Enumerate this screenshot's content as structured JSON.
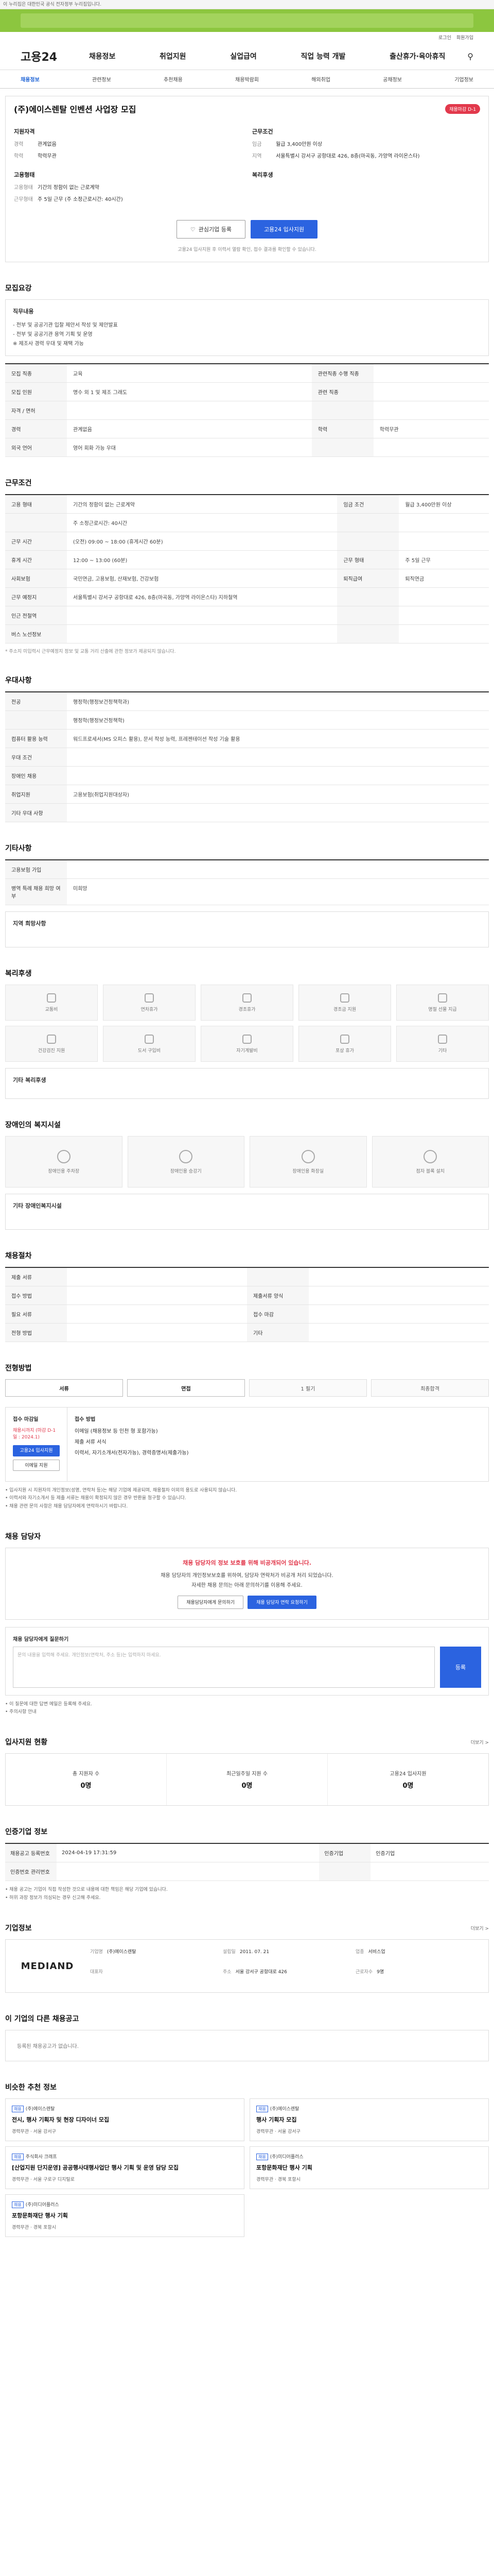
{
  "topbar": {
    "text": "이 누리집은 대한민국 공식 전자정부 누리집입니다."
  },
  "util": [
    "로그인",
    "회원가입"
  ],
  "gnb": {
    "logo": "고용24",
    "menu": [
      "채용정보",
      "취업지원",
      "실업급여",
      "직업 능력 개발",
      "출산휴가·육아휴직"
    ]
  },
  "subnav": [
    "채용정보",
    "관련정보",
    "추천채용",
    "채용박람회",
    "해외취업",
    "공채정보",
    "기업정보"
  ],
  "job": {
    "title": "(주)에이스렌탈 인벤션 사업장 모집",
    "dday": "채용마감 D-1",
    "overview_left_label": "지원자격",
    "overview_right_label": "근무조건",
    "left_kv": [
      {
        "k": "경력",
        "v": "관계없음"
      },
      {
        "k": "학력",
        "v": "학력무관"
      }
    ],
    "right_kv": [
      {
        "k": "임금",
        "v": "월급 3,400만원 이상"
      },
      {
        "k": "지역",
        "v": "서울특별시 강서구 공항대로 426, 8층(마곡동, 가양역 라이온스타)"
      }
    ],
    "employ_label": "고용형태",
    "employ_kv": [
      {
        "k": "고용형태",
        "v": "기간의 정함이 없는 근로계약"
      },
      {
        "k": "근무형태",
        "v": "주 5일 근무 (주 소정근로시간: 40시간)"
      }
    ],
    "welfare_label": "복리후생",
    "btn_interest": "관심기업 등록",
    "btn_apply": "고용24 입사지원",
    "apply_note": "고용24 입사지원 후 이력서 열람 확인, 접수 결과를 확인할 수 있습니다.",
    "apply_note_em": "고용24 입사지원"
  },
  "sections": {
    "recruit": "모집요강",
    "conditions": "근무조건",
    "preference": "우대사항",
    "other": "기타사항",
    "welfare": "복리후생",
    "welfare2": "장애인의 복지시설",
    "process": "채용절차",
    "schedule": "전형방법",
    "manager": "채용 담당자",
    "applicants": "입사지원 현황",
    "meta": "인증기업 정보",
    "company": "기업정보",
    "others": "이 기업의 다른 채용공고",
    "recommended": "비슷한 추천 정보"
  },
  "recruit_box": {
    "title": "직무내용",
    "lines": [
      "- 전부 및 공공기관 입찰 제안서 작성 및 제안발표",
      "- 전부 및 공공기관 용역 기획 및 운영",
      "※ 제조사 경력 우대 및 재택 가능"
    ]
  },
  "recruit_table": [
    {
      "k": "모집 직종",
      "v": "교육",
      "k2": "관련직종 수행 직종",
      "v2": ""
    },
    {
      "k": "모집 인원",
      "v": "명수 외 1 및 제조 그래도",
      "k2": "관련 직종",
      "v2": ""
    },
    {
      "k": "자격 / 면허",
      "v": "",
      "k2": "",
      "v2": ""
    },
    {
      "k": "경력",
      "v": "관계없음",
      "k2": "학력",
      "v2": "학력무관"
    },
    {
      "k": "외국 언어",
      "v": "영어 회화 가능 우대",
      "k2": "",
      "v2": ""
    }
  ],
  "cond_table": [
    {
      "k": "고용 형태",
      "v": "기간의 정함이 없는 근로계약",
      "k2": "임금 조건",
      "v2": "월급 3,400만원 이상"
    },
    {
      "k": "",
      "v": "주 소정근로시간: 40시간",
      "k2": "",
      "v2": ""
    },
    {
      "k": "근무 시간",
      "v": "(오전) 09:00 ~ 18:00 (휴게시간 60분)",
      "k2": "",
      "v2": ""
    },
    {
      "k": "휴게 시간",
      "v": "12:00 ~ 13:00 (60분)",
      "k2": "근무 형태",
      "v2": "주 5일 근무"
    },
    {
      "k": "사회보험",
      "v": "국민연금, 고용보험, 산재보험, 건강보험",
      "k2": "퇴직급여",
      "v2": "퇴직연금"
    },
    {
      "k": "근무 예정지",
      "v": "서울특별시 강서구 공항대로 426, 8층(마곡동, 가양역 라이온스타) 지하철역",
      "k2": "",
      "v2": ""
    },
    {
      "k": "인근 전철역",
      "v": "",
      "k2": "",
      "v2": ""
    },
    {
      "k": "버스 노선정보",
      "v": "",
      "k2": "",
      "v2": ""
    }
  ],
  "cond_note": "* 주소지 미입력시 근무예정지 정보 및 교통 거리 산출에 관한 정보가 제공되지 않습니다.",
  "pref_table": [
    {
      "k": "전공",
      "v": "행정학(행정보건정책학과)"
    },
    {
      "k": "",
      "v": "행정학(행정보건정책학)"
    },
    {
      "k": "컴퓨터 활용 능력",
      "v": "워드프로세서(MS 오피스 활용), 문서 작성 능력, 프레젠테이션 작성 기술 활용"
    },
    {
      "k": "우대 조건",
      "v": ""
    },
    {
      "k": "장애인 채용",
      "v": ""
    },
    {
      "k": "취업지원",
      "v": "고용보험(취업지원대상자)"
    },
    {
      "k": "기타 우대 사항",
      "v": ""
    }
  ],
  "other_table": [
    {
      "k": "고용보험 가입",
      "v": ""
    },
    {
      "k": "병역 특례 채용 희망 여부",
      "v": "미희망"
    }
  ],
  "other_box": "지역 희망사항",
  "welfare_items": [
    "교통비",
    "연차휴가",
    "경조휴가",
    "경조금 지원",
    "명절 선물 지급",
    "건강검진 지원",
    "도서 구입비",
    "자기계발비",
    "포상 휴가",
    "기타"
  ],
  "welfare_detail_label": "기타 복리후생",
  "welfare2_items": [
    "장애인용 주차장",
    "장애인용 승강기",
    "장애인용 화장실",
    "점자 블록 설치"
  ],
  "welfare2_detail_label": "기타 장애인복지시설",
  "process_table": [
    {
      "k": "제출 서류",
      "v": "",
      "k2": "",
      "v2": ""
    },
    {
      "k": "접수 방법",
      "v": "",
      "k2": "제출서류 양식",
      "v2": ""
    },
    {
      "k": "필요 서류",
      "v": "",
      "k2": "접수 마감",
      "v2": ""
    },
    {
      "k": "전형 방법",
      "v": "",
      "k2": "기타",
      "v2": ""
    }
  ],
  "steps": [
    "서류",
    "면접",
    "1 필기",
    "최종합격"
  ],
  "apply_box": {
    "label": "접수 마감일",
    "deadline": "채용시까지 (마감 D-1일 : 2024.1)",
    "btn1": "고용24 입사지원",
    "btn2": "이메일 지원",
    "right_label": "접수 방법",
    "right_lines": [
      "이메일 (채용정보 등 인천 형 포함가능)",
      "제출 서류 서식",
      "이력서, 자기소개서(전자가능), 경력증명서(제출가능)"
    ]
  },
  "bullets": [
    "• 입사지원 시 지원자의 개인정보(성명, 연락처 등)는 해당 기업에 제공되며, 채용절차 이외의 용도로 사용되지 않습니다.",
    "• 이력서와 자기소개서 등 제출 서류는 채용이 확정되지 않은 경우 반환을 청구할 수 있습니다.",
    "• 채용 관련 문의 사항은 채용 담당자에게 연락하시기 바랍니다."
  ],
  "manager": {
    "notice_h": "채용 담당자의 정보 보호를 위해 비공개되어 있습니다.",
    "notice_lines": [
      "채용 담당자의 개인정보보호를 위하여, 담당자 연락처가 비공개 처리 되었습니다.",
      "자세한 채용 문의는 아래 문의하기를 이용해 주세요."
    ],
    "btn1": "채용담당자에게 문의하기",
    "btn2": "채용 담당자 연락 요청하기",
    "ask_label": "채용 담당자에게 질문하기",
    "ask_placeholder": "문의 내용을 입력해 주세요. 개인정보(연락처, 주소 등)는 입력하지 마세요.",
    "ask_btn": "등록",
    "ask_notes": [
      "• 이 질문에 대한 답변 메일은 등록해 주세요.",
      "• 주의사항 안내"
    ]
  },
  "applicants": [
    {
      "label": "총 지원자 수",
      "value": "0명"
    },
    {
      "label": "최근일주일 지원 수",
      "value": "0명"
    },
    {
      "label": "고용24 입사지원",
      "value": "0명"
    }
  ],
  "applicants_more": "더보기 >",
  "meta_table": [
    {
      "k": "채용공고 등록번호",
      "v": "2024-04-19 17:31:59",
      "k2": "인증기업",
      "v2": "인증기업"
    },
    {
      "k": "인증번호 관리번호",
      "v": "",
      "k2": "",
      "v2": ""
    }
  ],
  "meta_notes": [
    "• 채용 공고는 기업이 직접 작성한 것으로 내용에 대한 책임은 해당 기업에 있습니다.",
    "• 허위 과장 정보가 의심되는 경우 신고해 주세요."
  ],
  "company": {
    "logo": "MEDIAND",
    "more": "더보기 >",
    "info": [
      {
        "k": "기업명",
        "v": "(주)에이스렌탈"
      },
      {
        "k": "설립일",
        "v": "2011. 07. 21"
      },
      {
        "k": "업종",
        "v": "서비스업"
      },
      {
        "k": "대표자",
        "v": ""
      },
      {
        "k": "주소",
        "v": "서울 강서구 공항대로 426"
      },
      {
        "k": "근로자수",
        "v": "9명"
      }
    ]
  },
  "others_empty": "등록된 채용공고가 없습니다.",
  "recommend": [
    {
      "badge": "채용",
      "co": "(주)에이스렌탈",
      "title": "전시, 행사 기획자 및 현장 디자이너 모집",
      "meta": "경력무관 · 서울 강서구"
    },
    {
      "badge": "채용",
      "co": "(주)에이스렌탈",
      "title": "행사 기획자 모집",
      "meta": "경력무관 · 서울 강서구"
    },
    {
      "badge": "채용",
      "co": "주식회사 크래프",
      "title": "[산업지원 단지운영] 공공행사대행사업단 행사 기획 및 운영 담당 모집",
      "meta": "경력무관 · 서울 구로구 디지털로"
    },
    {
      "badge": "채용",
      "co": "(주)미디어플러스",
      "title": "포항문화재단 행사 기획",
      "meta": "경력무관 · 경북 포항시"
    },
    {
      "badge": "채용",
      "co": "(주)미디어플러스",
      "title": "포항문화재단 행사 기획",
      "meta": "경력무관 · 경북 포항시"
    }
  ]
}
